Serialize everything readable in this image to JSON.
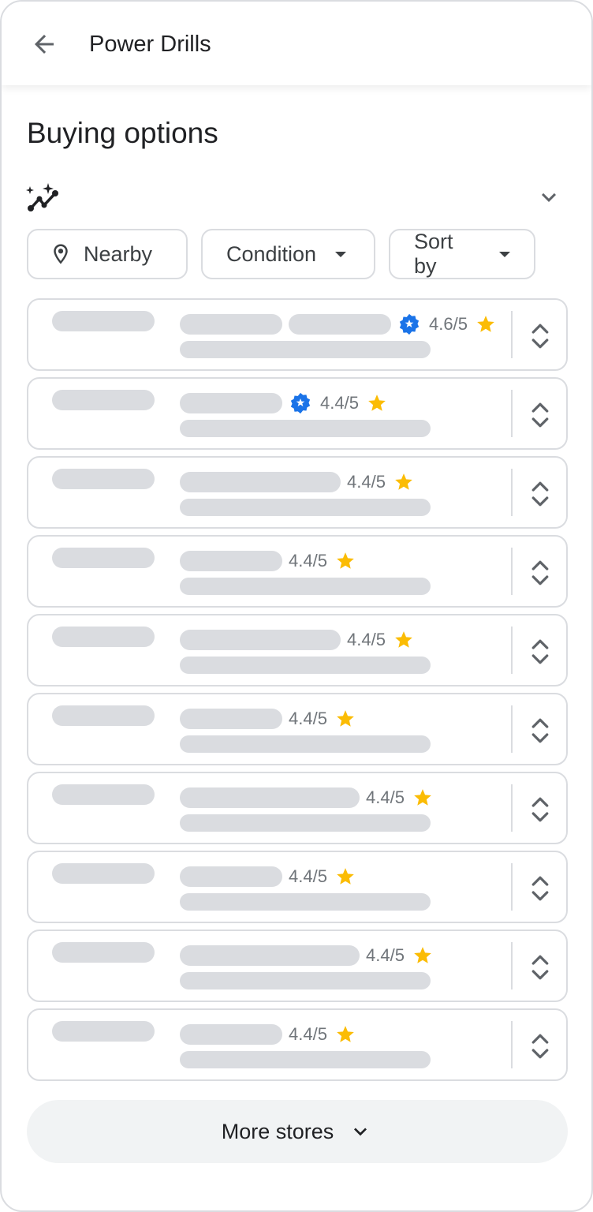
{
  "app_bar": {
    "back_icon": "arrow-back-icon",
    "title": "Power Drills"
  },
  "section": {
    "title": "Buying options",
    "insights_icon": "sparkle-trend-icon",
    "collapse_icon": "chevron-down-icon"
  },
  "filters": [
    {
      "label": "Nearby",
      "icon": "location-pin-icon",
      "dropdown": false
    },
    {
      "label": "Condition",
      "icon": null,
      "dropdown": true
    },
    {
      "label": "Sort by",
      "icon": null,
      "dropdown": true
    }
  ],
  "colors": {
    "verified_badge": "#1a73e8",
    "star": "#fbbc04",
    "skeleton": "#dadce0",
    "border": "#dadce0",
    "rating_text": "#70757a"
  },
  "offers": [
    {
      "rating": "4.6/5",
      "verified": true,
      "loading": true
    },
    {
      "rating": "4.4/5",
      "verified": true,
      "loading": true
    },
    {
      "rating": "4.4/5",
      "verified": false,
      "loading": true
    },
    {
      "rating": "4.4/5",
      "verified": false,
      "loading": true
    },
    {
      "rating": "4.4/5",
      "verified": false,
      "loading": true
    },
    {
      "rating": "4.4/5",
      "verified": false,
      "loading": true
    },
    {
      "rating": "4.4/5",
      "verified": false,
      "loading": true
    },
    {
      "rating": "4.4/5",
      "verified": false,
      "loading": true
    },
    {
      "rating": "4.4/5",
      "verified": false,
      "loading": true
    },
    {
      "rating": "4.4/5",
      "verified": false,
      "loading": true
    }
  ],
  "more_button": {
    "label": "More stores",
    "icon": "chevron-down-icon"
  }
}
